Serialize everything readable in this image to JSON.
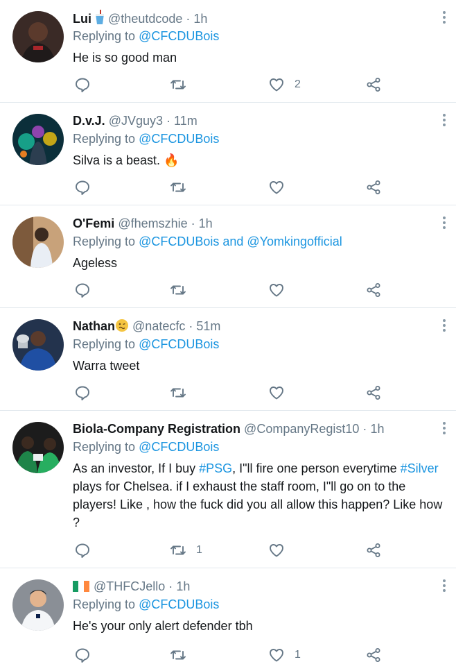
{
  "tweets": [
    {
      "name": "Lui",
      "name_emoji": "cup-emoji",
      "handle": "@theutdcode",
      "time": "1h",
      "replying_prefix": "Replying to",
      "replying_to": "@CFCDUBois",
      "text": "He is so good man",
      "likes": "2",
      "retweets": ""
    },
    {
      "name": "D.v.J.",
      "handle": "@JVguy3",
      "time": "11m",
      "replying_prefix": "Replying to",
      "replying_to": "@CFCDUBois",
      "text": "Silva is a beast. 🔥",
      "likes": "",
      "retweets": ""
    },
    {
      "name": "O'Femi",
      "handle": "@fhemszhie",
      "time": "1h",
      "replying_prefix": "Replying to",
      "replying_to": "@CFCDUBois and @Yomkingofficial",
      "text": "Ageless",
      "likes": "",
      "retweets": ""
    },
    {
      "name": "Nathan",
      "name_emoji": "woozy-face-emoji",
      "handle": "@natecfc",
      "time": "51m",
      "replying_prefix": "Replying to",
      "replying_to": "@CFCDUBois",
      "text": "Warra tweet",
      "likes": "",
      "retweets": ""
    },
    {
      "name": "Biola-Company Registration",
      "handle": "@CompanyRegist10",
      "time": "1h",
      "replying_prefix": "Replying to",
      "replying_to": "@CFCDUBois",
      "text_parts": {
        "p1": "As an  investor, If I buy ",
        "tag1": "#PSG",
        "p2": ", I\"ll fire one person everytime ",
        "tag2": "#Silver",
        "p3": " plays for Chelsea.  if I exhaust the staff room, I\"ll go on to the players! Like , how the fuck did you all allow this happen? Like how ?"
      },
      "likes": "",
      "retweets": "1"
    },
    {
      "name": "",
      "name_emoji": "ireland-flag-emoji",
      "handle": "@THFCJello",
      "time": "1h",
      "replying_prefix": "Replying to",
      "replying_to": "@CFCDUBois",
      "text": "He's your only alert defender tbh",
      "likes": "1",
      "retweets": ""
    }
  ],
  "separator": "·",
  "colors": {
    "link": "#1b95e0",
    "secondary_text": "#657786",
    "primary_text": "#14171a",
    "divider": "#e1e8ed",
    "icon": "#657786"
  },
  "icons": {
    "reply": "reply-icon",
    "retweet": "retweet-icon",
    "like": "heart-icon",
    "share": "share-icon",
    "more": "more-vertical-icon"
  }
}
